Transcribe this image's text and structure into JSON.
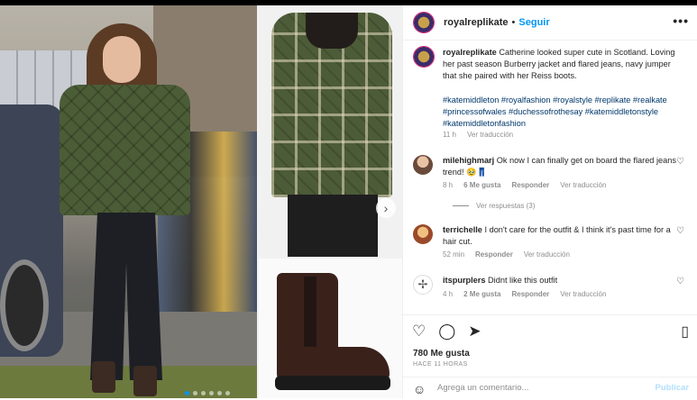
{
  "post": {
    "username": "royalreplikate",
    "follow_label": "Seguir",
    "more_label": "•••",
    "caption": "Catherine looked super cute in Scotland. Loving her past season Burberry jacket and flared jeans, navy jumper that she paired with her Reiss boots.",
    "hashtags": "#katemiddleton #royalfashion #royalstyle #replikate #realkate #princessofwales #duchessofrothesay #katemiddletonstyle #katemiddletonfashion",
    "caption_time": "11 h",
    "caption_translate": "Ver traducción"
  },
  "comments": [
    {
      "username": "milehighmarj",
      "text": "Ok now I can finally get on board the flared jeans trend! 🥹👖",
      "time": "8 h",
      "likes": "6 Me gusta",
      "reply": "Responder",
      "translate": "Ver traducción",
      "view_replies": "Ver respuestas (3)"
    },
    {
      "username": "terrichelle",
      "text": "I don't care for the outfit & I think it's past time for a hair cut.",
      "time": "52 min",
      "reply": "Responder",
      "translate": "Ver traducción"
    },
    {
      "username": "itspurplers",
      "text": "Didnt like this outfit",
      "time": "4 h",
      "likes": "2 Me gusta",
      "reply": "Responder",
      "translate": "Ver traducción"
    }
  ],
  "actions": {
    "likes": "780 Me gusta",
    "timestamp": "HACE 11 HORAS",
    "comment_placeholder": "Agrega un comentario...",
    "publish_label": "Publicar"
  },
  "icons": {
    "like": "heart-icon",
    "comment": "comment-icon",
    "share": "share-icon",
    "save": "bookmark-icon",
    "emoji": "emoji-icon",
    "next": "chevron-right-icon"
  },
  "colors": {
    "accent": "#0095f6",
    "link": "#00376b",
    "muted": "#8e8e8e",
    "text": "#262626",
    "publish_disabled": "#b2dffc"
  }
}
